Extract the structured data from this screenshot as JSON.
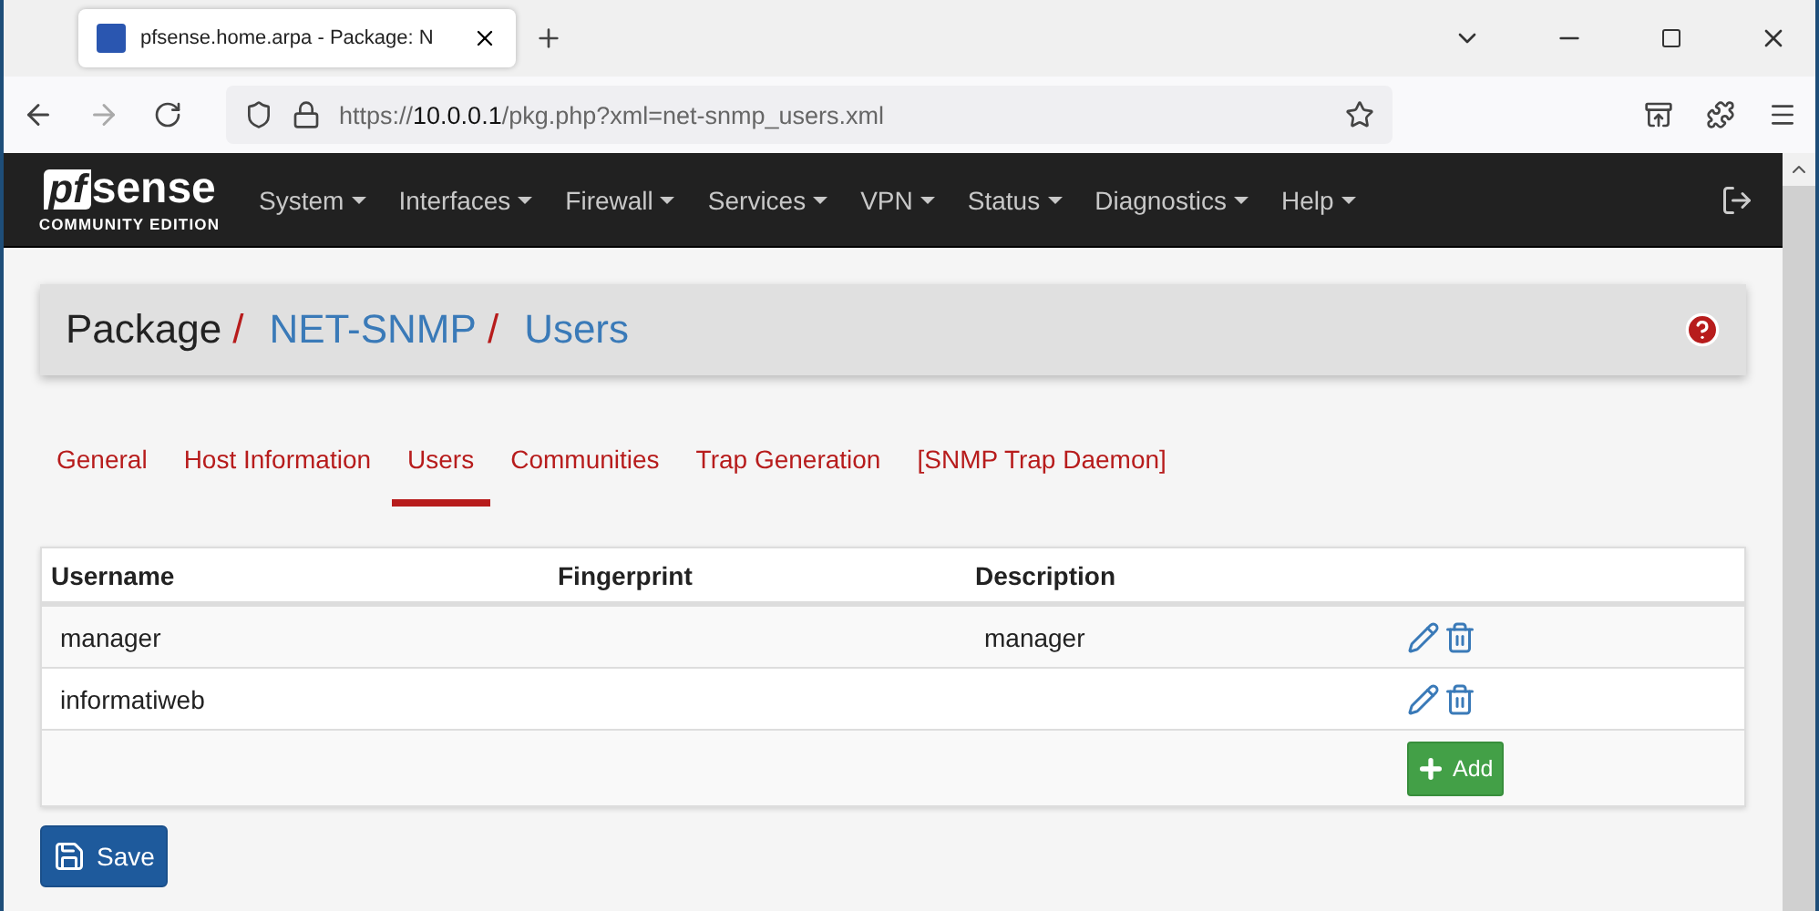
{
  "browser": {
    "tab_title": "pfsense.home.arpa - Package: N",
    "url_prefix": "https://",
    "url_host": "10.0.0.1",
    "url_path": "/pkg.php?xml=net-snmp_users.xml"
  },
  "logo": {
    "mark": "pf",
    "word": "sense",
    "edition": "COMMUNITY EDITION"
  },
  "menu": [
    {
      "label": "System"
    },
    {
      "label": "Interfaces"
    },
    {
      "label": "Firewall"
    },
    {
      "label": "Services"
    },
    {
      "label": "VPN"
    },
    {
      "label": "Status"
    },
    {
      "label": "Diagnostics"
    },
    {
      "label": "Help"
    }
  ],
  "breadcrumb_separator": "/",
  "breadcrumb": [
    {
      "label": "Package",
      "kind": "plain"
    },
    {
      "label": "NET-SNMP",
      "kind": "link"
    },
    {
      "label": "Users",
      "kind": "link"
    }
  ],
  "tabs": [
    {
      "label": "General",
      "selected": false
    },
    {
      "label": "Host Information",
      "selected": false
    },
    {
      "label": "Users",
      "selected": true
    },
    {
      "label": "Communities",
      "selected": false
    },
    {
      "label": "Trap Generation",
      "selected": false
    },
    {
      "label": "[SNMP Trap Daemon]",
      "selected": false
    }
  ],
  "table": {
    "columns": [
      "Username",
      "Fingerprint",
      "Description"
    ],
    "rows": [
      {
        "username": "manager",
        "description": "manager"
      },
      {
        "username": "informatiweb"
      }
    ],
    "add_button": "Add"
  },
  "save_button": "Save"
}
